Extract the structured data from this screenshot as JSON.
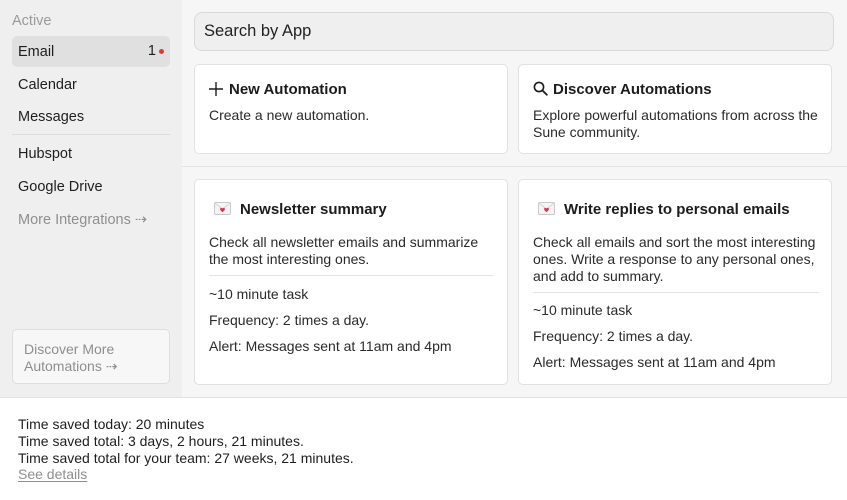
{
  "sidebar": {
    "section_label": "Active",
    "items": [
      {
        "label": "Email",
        "badge": "1"
      },
      {
        "label": "Calendar"
      },
      {
        "label": "Messages"
      },
      {
        "label": "Hubspot"
      },
      {
        "label": "Google Drive"
      },
      {
        "label": "More Integrations ⇢"
      }
    ],
    "discover_more": "Discover More Automations ⇢",
    "badge_dot_color": "#e03a2f"
  },
  "search": {
    "placeholder": "Search by App"
  },
  "actions": {
    "new": {
      "title": "New Automation",
      "desc": "Create a new automation.",
      "icon": "plus-icon"
    },
    "discover": {
      "title": "Discover Automations",
      "desc": "Explore powerful automations from across the Sune community.",
      "icon": "search-icon"
    }
  },
  "automations": [
    {
      "icon": "love-letter-icon",
      "title": "Newsletter summary",
      "desc": "Check all newsletter emails and summarize the most interesting ones.",
      "duration": "~10 minute task",
      "frequency": "Frequency: 2 times a day.",
      "alert": "Alert: Messages sent at 11am and 4pm"
    },
    {
      "icon": "love-letter-icon",
      "title": "Write replies to personal emails",
      "desc": "Check all emails and sort the most interesting ones. Write a response to any personal ones, and add to summary.",
      "duration": "~10 minute task",
      "frequency": "Frequency: 2 times a day.",
      "alert": "Alert: Messages sent at 11am and 4pm"
    }
  ],
  "stats": {
    "today": "Time saved today: 20 minutes",
    "total": "Time saved total: 3 days, 2 hours, 21 minutes.",
    "team": "Time saved total for your team: 27 weeks, 21 minutes.",
    "see_details": "See details"
  }
}
